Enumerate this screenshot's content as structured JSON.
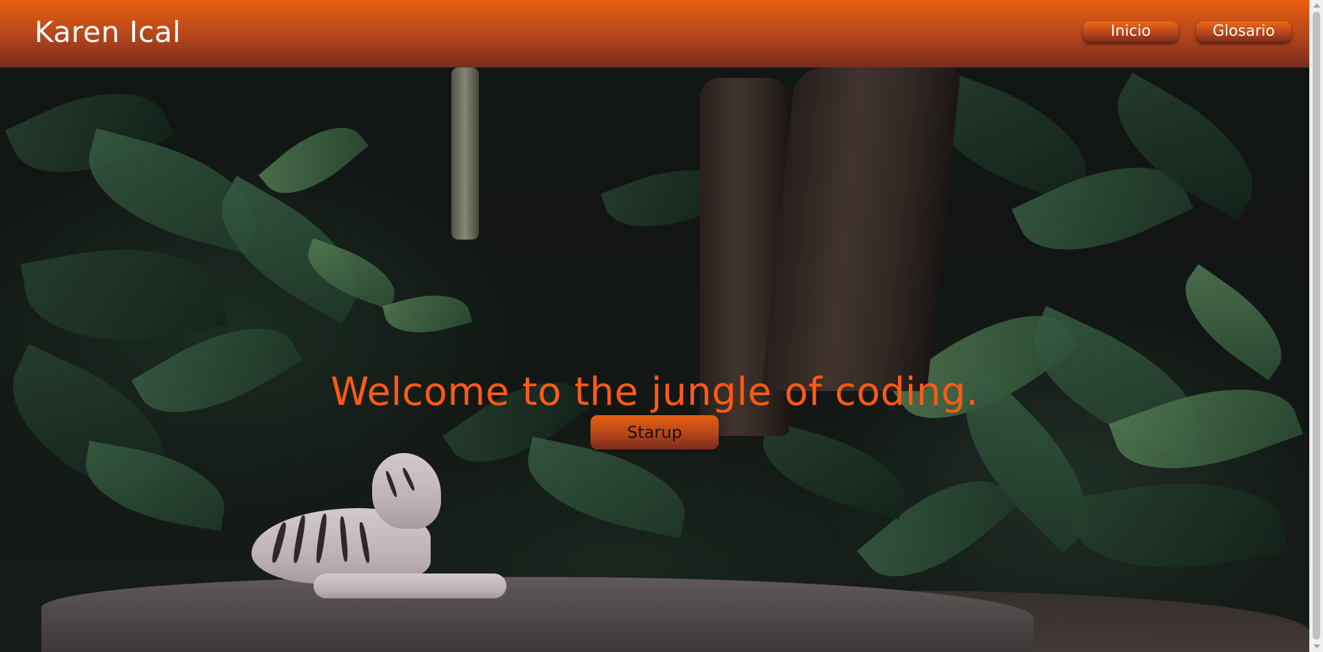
{
  "header": {
    "brand": "Karen Ical",
    "nav": [
      {
        "label": "Inicio"
      },
      {
        "label": "Glosario"
      }
    ]
  },
  "hero": {
    "title": "Welcome to the jungle of coding.",
    "cta_label": "Starup",
    "background": "jungle-with-white-tiger-image"
  },
  "colors": {
    "header_gradient_top": "#e8600f",
    "header_gradient_bottom": "#7a2b1e",
    "title_accent": "#ff5a14",
    "nav_text": "#ffffff"
  }
}
